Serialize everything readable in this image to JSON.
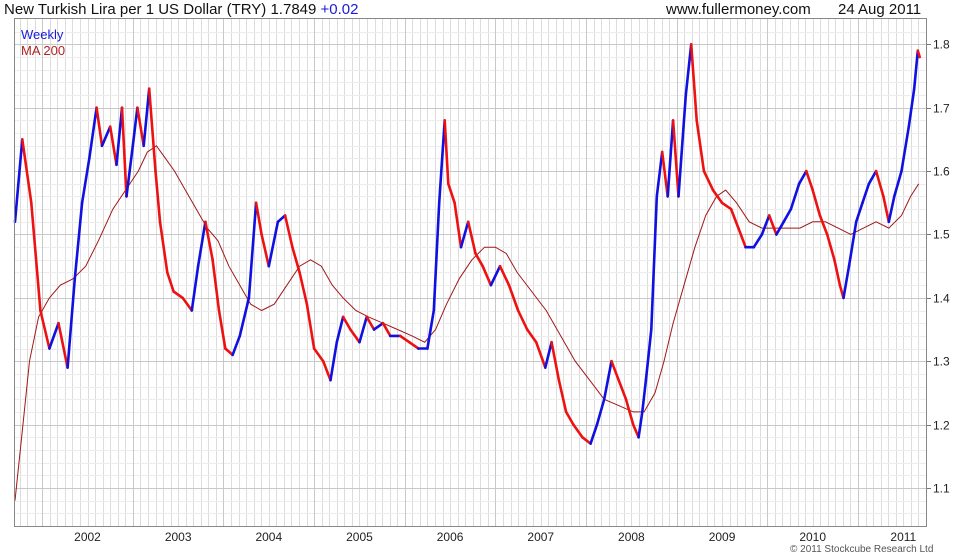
{
  "header": {
    "title": "New Turkish Lira per 1 US Dollar (TRY)",
    "last_value": "1.7849",
    "change": "+0.02",
    "site": "www.fullermoney.com",
    "date": "24 Aug 2011"
  },
  "legend": {
    "weekly": "Weekly",
    "ma": "MA 200"
  },
  "copyright": "© 2011 Stockcube Research Ltd",
  "chart_data": {
    "type": "line",
    "x_ticks": [
      "2002",
      "2003",
      "2004",
      "2005",
      "2006",
      "2007",
      "2008",
      "2009",
      "2010",
      "2011"
    ],
    "y_ticks": [
      "1.1",
      "1.2",
      "1.3",
      "1.4",
      "1.5",
      "1.6",
      "1.7",
      "1.8"
    ],
    "ylim": [
      1.04,
      1.84
    ],
    "xlim": [
      2001.7,
      2011.75
    ],
    "grid": true,
    "colors": {
      "up": "#1010e0",
      "down": "#ee1111",
      "ma": "#a01818",
      "grid": "#dcdcdc"
    },
    "series": [
      {
        "name": "Weekly",
        "points": [
          [
            2001.7,
            1.52
          ],
          [
            2001.78,
            1.65
          ],
          [
            2001.88,
            1.55
          ],
          [
            2001.98,
            1.38
          ],
          [
            2002.08,
            1.32
          ],
          [
            2002.18,
            1.36
          ],
          [
            2002.28,
            1.29
          ],
          [
            2002.36,
            1.43
          ],
          [
            2002.44,
            1.55
          ],
          [
            2002.52,
            1.62
          ],
          [
            2002.6,
            1.7
          ],
          [
            2002.66,
            1.64
          ],
          [
            2002.75,
            1.67
          ],
          [
            2002.82,
            1.61
          ],
          [
            2002.88,
            1.7
          ],
          [
            2002.93,
            1.56
          ],
          [
            2003.0,
            1.64
          ],
          [
            2003.05,
            1.7
          ],
          [
            2003.12,
            1.64
          ],
          [
            2003.18,
            1.73
          ],
          [
            2003.25,
            1.6
          ],
          [
            2003.3,
            1.52
          ],
          [
            2003.38,
            1.44
          ],
          [
            2003.45,
            1.41
          ],
          [
            2003.55,
            1.4
          ],
          [
            2003.65,
            1.38
          ],
          [
            2003.72,
            1.45
          ],
          [
            2003.8,
            1.52
          ],
          [
            2003.88,
            1.46
          ],
          [
            2003.95,
            1.38
          ],
          [
            2004.02,
            1.32
          ],
          [
            2004.1,
            1.31
          ],
          [
            2004.18,
            1.34
          ],
          [
            2004.28,
            1.4
          ],
          [
            2004.36,
            1.55
          ],
          [
            2004.42,
            1.5
          ],
          [
            2004.5,
            1.45
          ],
          [
            2004.6,
            1.52
          ],
          [
            2004.68,
            1.53
          ],
          [
            2004.76,
            1.48
          ],
          [
            2004.84,
            1.44
          ],
          [
            2004.92,
            1.39
          ],
          [
            2005.0,
            1.32
          ],
          [
            2005.1,
            1.3
          ],
          [
            2005.18,
            1.27
          ],
          [
            2005.25,
            1.33
          ],
          [
            2005.32,
            1.37
          ],
          [
            2005.4,
            1.35
          ],
          [
            2005.5,
            1.33
          ],
          [
            2005.58,
            1.37
          ],
          [
            2005.66,
            1.35
          ],
          [
            2005.76,
            1.36
          ],
          [
            2005.84,
            1.34
          ],
          [
            2005.95,
            1.34
          ],
          [
            2006.05,
            1.33
          ],
          [
            2006.15,
            1.32
          ],
          [
            2006.25,
            1.32
          ],
          [
            2006.32,
            1.38
          ],
          [
            2006.38,
            1.55
          ],
          [
            2006.44,
            1.68
          ],
          [
            2006.48,
            1.58
          ],
          [
            2006.55,
            1.55
          ],
          [
            2006.62,
            1.48
          ],
          [
            2006.7,
            1.52
          ],
          [
            2006.78,
            1.47
          ],
          [
            2006.86,
            1.45
          ],
          [
            2006.95,
            1.42
          ],
          [
            2007.05,
            1.45
          ],
          [
            2007.15,
            1.42
          ],
          [
            2007.25,
            1.38
          ],
          [
            2007.35,
            1.35
          ],
          [
            2007.45,
            1.33
          ],
          [
            2007.55,
            1.29
          ],
          [
            2007.62,
            1.33
          ],
          [
            2007.7,
            1.27
          ],
          [
            2007.78,
            1.22
          ],
          [
            2007.86,
            1.2
          ],
          [
            2007.96,
            1.18
          ],
          [
            2008.05,
            1.17
          ],
          [
            2008.12,
            1.2
          ],
          [
            2008.2,
            1.24
          ],
          [
            2008.28,
            1.3
          ],
          [
            2008.36,
            1.27
          ],
          [
            2008.44,
            1.24
          ],
          [
            2008.52,
            1.2
          ],
          [
            2008.58,
            1.18
          ],
          [
            2008.62,
            1.22
          ],
          [
            2008.66,
            1.27
          ],
          [
            2008.72,
            1.35
          ],
          [
            2008.78,
            1.56
          ],
          [
            2008.84,
            1.63
          ],
          [
            2008.9,
            1.56
          ],
          [
            2008.96,
            1.68
          ],
          [
            2009.02,
            1.56
          ],
          [
            2009.1,
            1.72
          ],
          [
            2009.16,
            1.8
          ],
          [
            2009.22,
            1.68
          ],
          [
            2009.3,
            1.6
          ],
          [
            2009.4,
            1.57
          ],
          [
            2009.5,
            1.55
          ],
          [
            2009.6,
            1.54
          ],
          [
            2009.68,
            1.51
          ],
          [
            2009.76,
            1.48
          ],
          [
            2009.85,
            1.48
          ],
          [
            2009.94,
            1.5
          ],
          [
            2010.02,
            1.53
          ],
          [
            2010.1,
            1.5
          ],
          [
            2010.18,
            1.52
          ],
          [
            2010.26,
            1.54
          ],
          [
            2010.35,
            1.58
          ],
          [
            2010.43,
            1.6
          ],
          [
            2010.5,
            1.57
          ],
          [
            2010.58,
            1.53
          ],
          [
            2010.66,
            1.5
          ],
          [
            2010.74,
            1.46
          ],
          [
            2010.8,
            1.42
          ],
          [
            2010.84,
            1.4
          ],
          [
            2010.9,
            1.45
          ],
          [
            2010.98,
            1.52
          ],
          [
            2011.05,
            1.55
          ],
          [
            2011.12,
            1.58
          ],
          [
            2011.2,
            1.6
          ],
          [
            2011.28,
            1.56
          ],
          [
            2011.34,
            1.52
          ],
          [
            2011.4,
            1.56
          ],
          [
            2011.48,
            1.6
          ],
          [
            2011.56,
            1.67
          ],
          [
            2011.62,
            1.73
          ],
          [
            2011.66,
            1.79
          ],
          [
            2011.68,
            1.78
          ]
        ]
      },
      {
        "name": "MA 200",
        "points": [
          [
            2001.7,
            1.08
          ],
          [
            2001.78,
            1.19
          ],
          [
            2001.86,
            1.3
          ],
          [
            2001.96,
            1.37
          ],
          [
            2002.08,
            1.4
          ],
          [
            2002.2,
            1.42
          ],
          [
            2002.34,
            1.43
          ],
          [
            2002.48,
            1.45
          ],
          [
            2002.62,
            1.49
          ],
          [
            2002.78,
            1.54
          ],
          [
            2002.92,
            1.57
          ],
          [
            2003.06,
            1.6
          ],
          [
            2003.16,
            1.63
          ],
          [
            2003.26,
            1.64
          ],
          [
            2003.36,
            1.62
          ],
          [
            2003.46,
            1.6
          ],
          [
            2003.58,
            1.57
          ],
          [
            2003.7,
            1.54
          ],
          [
            2003.82,
            1.51
          ],
          [
            2003.94,
            1.49
          ],
          [
            2004.06,
            1.45
          ],
          [
            2004.18,
            1.42
          ],
          [
            2004.3,
            1.39
          ],
          [
            2004.42,
            1.38
          ],
          [
            2004.56,
            1.39
          ],
          [
            2004.7,
            1.42
          ],
          [
            2004.84,
            1.45
          ],
          [
            2004.96,
            1.46
          ],
          [
            2005.08,
            1.45
          ],
          [
            2005.2,
            1.42
          ],
          [
            2005.32,
            1.4
          ],
          [
            2005.46,
            1.38
          ],
          [
            2005.6,
            1.37
          ],
          [
            2005.76,
            1.36
          ],
          [
            2005.92,
            1.35
          ],
          [
            2006.08,
            1.34
          ],
          [
            2006.22,
            1.33
          ],
          [
            2006.34,
            1.35
          ],
          [
            2006.46,
            1.39
          ],
          [
            2006.6,
            1.43
          ],
          [
            2006.74,
            1.46
          ],
          [
            2006.88,
            1.48
          ],
          [
            2007.0,
            1.48
          ],
          [
            2007.12,
            1.47
          ],
          [
            2007.24,
            1.44
          ],
          [
            2007.4,
            1.41
          ],
          [
            2007.56,
            1.38
          ],
          [
            2007.72,
            1.34
          ],
          [
            2007.88,
            1.3
          ],
          [
            2008.04,
            1.27
          ],
          [
            2008.2,
            1.24
          ],
          [
            2008.36,
            1.23
          ],
          [
            2008.52,
            1.22
          ],
          [
            2008.64,
            1.22
          ],
          [
            2008.76,
            1.25
          ],
          [
            2008.86,
            1.3
          ],
          [
            2008.96,
            1.36
          ],
          [
            2009.08,
            1.42
          ],
          [
            2009.2,
            1.48
          ],
          [
            2009.32,
            1.53
          ],
          [
            2009.44,
            1.56
          ],
          [
            2009.54,
            1.57
          ],
          [
            2009.66,
            1.55
          ],
          [
            2009.8,
            1.52
          ],
          [
            2009.94,
            1.51
          ],
          [
            2010.08,
            1.51
          ],
          [
            2010.22,
            1.51
          ],
          [
            2010.36,
            1.51
          ],
          [
            2010.5,
            1.52
          ],
          [
            2010.64,
            1.52
          ],
          [
            2010.78,
            1.51
          ],
          [
            2010.92,
            1.5
          ],
          [
            2011.06,
            1.51
          ],
          [
            2011.2,
            1.52
          ],
          [
            2011.34,
            1.51
          ],
          [
            2011.48,
            1.53
          ],
          [
            2011.58,
            1.56
          ],
          [
            2011.67,
            1.58
          ]
        ]
      }
    ]
  }
}
